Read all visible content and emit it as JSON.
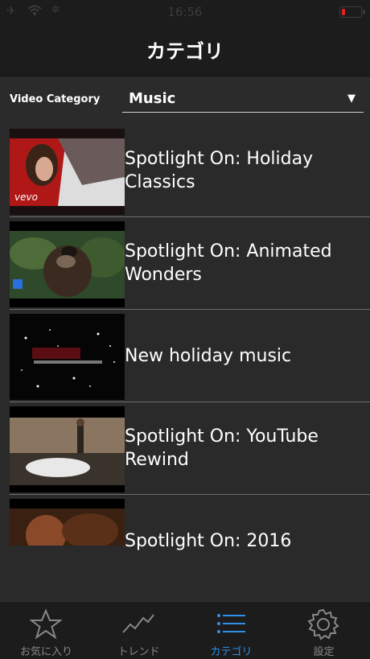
{
  "status_bar": {
    "time": "16:56",
    "battery_color": "#e02020"
  },
  "nav": {
    "title": "カテゴリ"
  },
  "category": {
    "label": "Video Category",
    "selected": "Music"
  },
  "items": [
    {
      "title": "Spotlight On: Holiday Classics",
      "thumb_text": "vevo"
    },
    {
      "title": "Spotlight On: Animated Wonders",
      "thumb_text": ""
    },
    {
      "title": "New holiday music",
      "thumb_text": ""
    },
    {
      "title": "Spotlight On: YouTube Rewind",
      "thumb_text": ""
    },
    {
      "title": "Spotlight On: 2016",
      "thumb_text": ""
    }
  ],
  "tabs": [
    {
      "label": "お気に入り",
      "icon": "star-icon"
    },
    {
      "label": "トレンド",
      "icon": "trend-icon"
    },
    {
      "label": "カテゴリ",
      "icon": "list-icon",
      "active": true
    },
    {
      "label": "設定",
      "icon": "gear-icon"
    }
  ],
  "colors": {
    "accent": "#2f8fe8",
    "background": "#2a2a2a",
    "bar": "#1c1c1c"
  }
}
